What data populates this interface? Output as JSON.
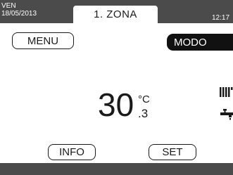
{
  "header": {
    "day": "VEN",
    "date": "18/05/2013",
    "zone_tab": "1. ZONA",
    "time": "12:17"
  },
  "buttons": {
    "menu": "MENU",
    "modo": "MODO",
    "info": "INFO",
    "set": "SET"
  },
  "temperature": {
    "integer": "30",
    "unit": "°C",
    "decimal": ".3"
  },
  "icons": [
    "radiator-icon",
    "tap-icon"
  ],
  "colors": {
    "bar": "#4b4b4b",
    "modo_button": "#111111",
    "background": "#ffffff"
  }
}
